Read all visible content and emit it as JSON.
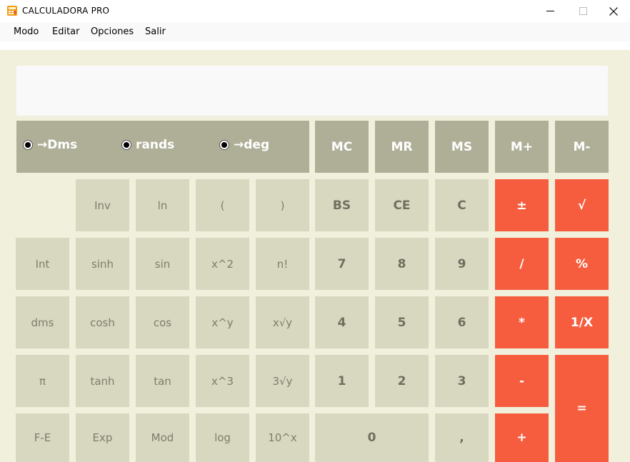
{
  "window": {
    "title": "CALCULADORA PRO",
    "controls": {
      "minimize": "—",
      "maximize": "☐",
      "close": "✕"
    }
  },
  "menu": [
    "Modo",
    "Editar",
    "Opciones",
    "Salir"
  ],
  "display": {
    "value": ""
  },
  "angle_modes": [
    {
      "label": "→Dms"
    },
    {
      "label": "rands"
    },
    {
      "label": "→deg"
    }
  ],
  "memory_buttons": [
    "MC",
    "MR",
    "MS",
    "M+",
    "M-"
  ],
  "sci": {
    "inv": "Inv",
    "ln": "ln",
    "lparen": "(",
    "rparen": ")",
    "int": "Int",
    "sinh": "sinh",
    "sin": "sin",
    "x2": "x^2",
    "fact": "n!",
    "dms": "dms",
    "cosh": "cosh",
    "cos": "cos",
    "xy": "x^y",
    "xroot": "x√y",
    "pi": "π",
    "tanh": "tanh",
    "tan": "tan",
    "x3": "x^3",
    "root3": "3√y",
    "fe": "F-E",
    "exp": "Exp",
    "mod": "Mod",
    "log": "log",
    "pow10": "10^x"
  },
  "edit": {
    "bs": "BS",
    "ce": "CE",
    "c": "C"
  },
  "digits": {
    "d7": "7",
    "d8": "8",
    "d9": "9",
    "d4": "4",
    "d5": "5",
    "d6": "6",
    "d1": "1",
    "d2": "2",
    "d3": "3",
    "d0": "0",
    "comma": ","
  },
  "ops": {
    "negate": "±",
    "sqrt": "√",
    "divide": "/",
    "percent": "%",
    "multiply": "*",
    "reciprocal": "1/X",
    "subtract": "-",
    "equals": "=",
    "add": "+"
  },
  "colors": {
    "background": "#f1f0dd",
    "memory": "#afaf98",
    "function": "#d8d8c0",
    "operator": "#f55d3e"
  }
}
